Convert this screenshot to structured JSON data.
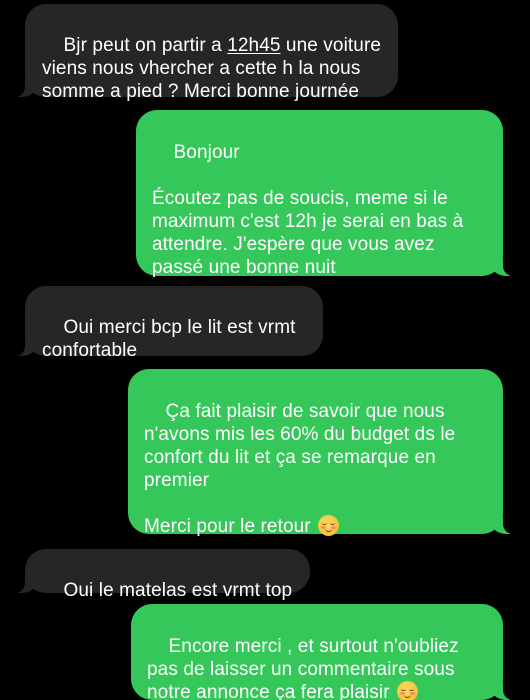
{
  "conversation": {
    "messages": [
      {
        "direction": "received",
        "before_link": "Bjr peut on partir a ",
        "link": "12h45",
        "after_link": " une voiture\nviens nous vhercher a cette h la nous\nsomme a pied ? Merci bonne journée"
      },
      {
        "direction": "sent",
        "text": "Bonjour\n\nÉcoutez pas de soucis, meme si le\nmaximum c'est 12h je serai en bas à\nattendre. J'espère que vous avez\npassé une bonne nuit"
      },
      {
        "direction": "received",
        "text": "Oui merci bcp le lit est vrmt\nconfortable"
      },
      {
        "direction": "sent",
        "text": "Ça fait plaisir de savoir que nous\nn'avons mis les 60% du budget ds le\nconfort du lit et ça se remarque en\npremier\n\nMerci pour le retour ",
        "emoji": "smiling-face-with-smiling-eyes"
      },
      {
        "direction": "received",
        "text": "Oui le matelas est vrmt top"
      },
      {
        "direction": "sent",
        "text": "Encore merci , et surtout n'oubliez\npas de laisser un commentaire sous\nnotre annonce ça fera plaisir ",
        "emoji": "smiling-face-with-smiling-eyes"
      }
    ]
  },
  "colors": {
    "background": "#000000",
    "received_bubble": "#262628",
    "sent_bubble": "#35c759",
    "text": "#ffffff"
  }
}
